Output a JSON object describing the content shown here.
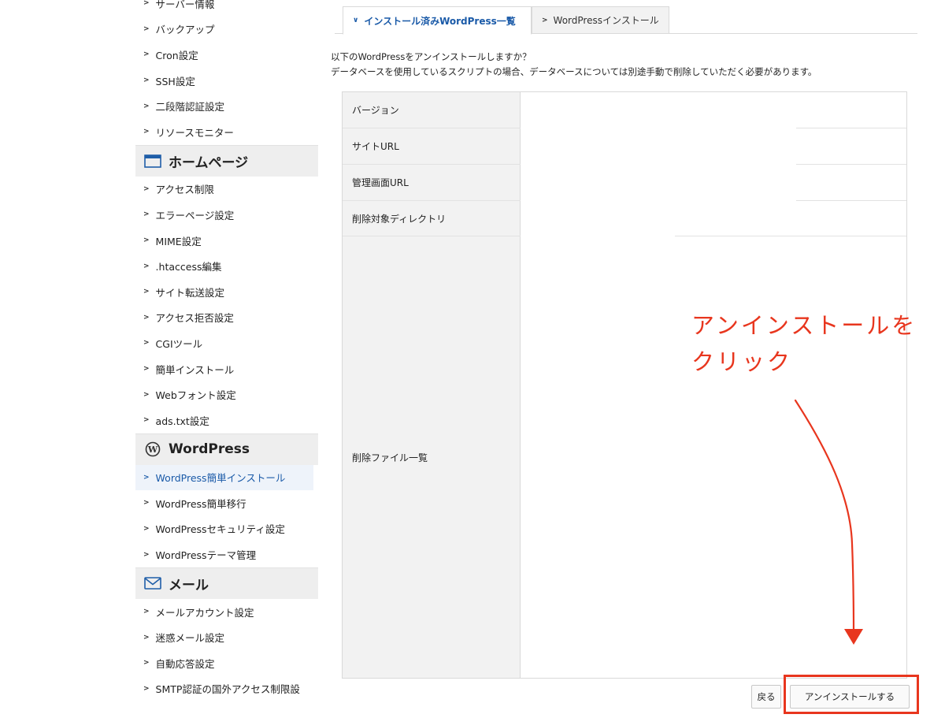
{
  "sidebar": {
    "items_top": [
      "サーバー情報",
      "バックアップ",
      "Cron設定",
      "SSH設定",
      "二段階認証設定",
      "リソースモニター"
    ],
    "homepage": {
      "title": "ホームページ",
      "icon": "browser-window-icon",
      "items": [
        "アクセス制限",
        "エラーページ設定",
        "MIME設定",
        ".htaccess編集",
        "サイト転送設定",
        "アクセス拒否設定",
        "CGIツール",
        "簡単インストール",
        "Webフォント設定",
        "ads.txt設定"
      ]
    },
    "wordpress": {
      "title": "WordPress",
      "icon": "wordpress-logo-icon",
      "items": [
        "WordPress簡単インストール",
        "WordPress簡単移行",
        "WordPressセキュリティ設定",
        "WordPressテーマ管理"
      ],
      "active_index": 0
    },
    "mail": {
      "title": "メール",
      "icon": "envelope-icon",
      "items": [
        "メールアカウント設定",
        "迷惑メール設定",
        "自動応答設定",
        "SMTP認証の国外アクセス制限設"
      ]
    }
  },
  "tabs": {
    "active": "インストール済みWordPress一覧",
    "inactive": "WordPressインストール"
  },
  "message": {
    "line1": "以下のWordPressをアンインストールしますか？",
    "line2": "データベースを使用しているスクリプトの場合、データベースについては別途手動で削除していただく必要があります。"
  },
  "table": {
    "version_label": "バージョン",
    "site_url_label": "サイトURL",
    "admin_url_label": "管理画面URL",
    "target_dir_label": "削除対象ディレクトリ",
    "file_list_label": "削除ファイル一覧"
  },
  "buttons": {
    "back": "戻る",
    "uninstall": "アンインストールする"
  },
  "annotation": {
    "line1": "アンインストールを",
    "line2": "クリック",
    "color": "#e8361e"
  },
  "colors": {
    "accent": "#1a5aa8",
    "annotation": "#e8361e"
  }
}
